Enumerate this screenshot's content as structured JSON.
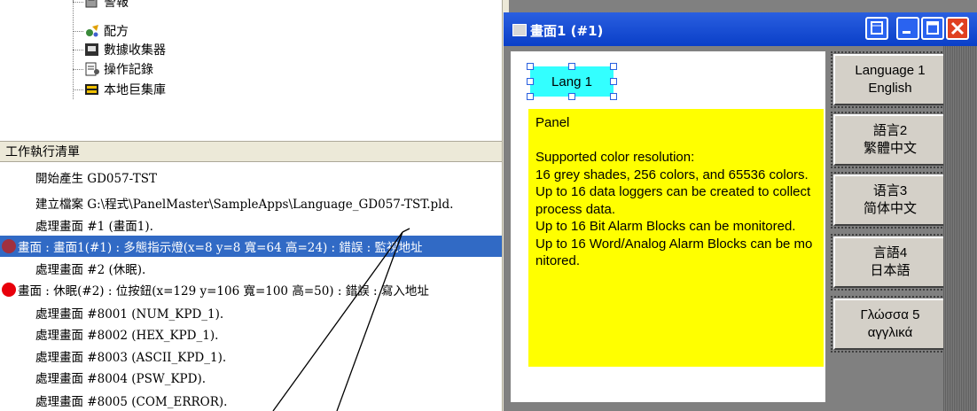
{
  "tree": {
    "items": [
      {
        "label": "警報",
        "icon": "alarm-icon"
      },
      {
        "label": "配方",
        "icon": "recipe-icon"
      },
      {
        "label": "數據收集器",
        "icon": "data-collector-icon"
      },
      {
        "label": "操作記錄",
        "icon": "operation-log-icon"
      },
      {
        "label": "本地巨集庫",
        "icon": "macro-library-icon"
      }
    ]
  },
  "task_list": {
    "header": "工作執行清單",
    "rows": [
      {
        "text": "開始產生 GD057-TST",
        "type": "info"
      },
      {
        "text": "建立檔案 G:\\程式\\PanelMaster\\SampleApps\\Language_GD057-TST.pld.",
        "type": "info"
      },
      {
        "text": "處理畫面 #1 (畫面1).",
        "type": "info"
      },
      {
        "text": "畫面 : 畫面1(#1) : 多態指示燈(x=8 y=8 寬=64 高=24) : 錯誤 : 監視地址",
        "type": "error",
        "selected": true
      },
      {
        "text": "處理畫面 #2 (休眠).",
        "type": "info"
      },
      {
        "text": "畫面 : 休眠(#2) : 位按鈕(x=129 y=106 寬=100 高=50) : 錯誤 : 寫入地址",
        "type": "error"
      },
      {
        "text": "處理畫面 #8001 (NUM_KPD_1).",
        "type": "info"
      },
      {
        "text": "處理畫面 #8002 (HEX_KPD_1).",
        "type": "info"
      },
      {
        "text": "處理畫面 #8003 (ASCII_KPD_1).",
        "type": "info"
      },
      {
        "text": "處理畫面 #8004 (PSW_KPD).",
        "type": "info"
      },
      {
        "text": "處理畫面 #8005 (COM_ERROR).",
        "type": "info"
      }
    ]
  },
  "window": {
    "title": "畫面1 (#1)",
    "buttons": {
      "restore": "restore-icon",
      "minimize": "minimize-icon",
      "maximize": "maximize-icon",
      "close": "close-icon"
    }
  },
  "screen": {
    "lang_selector": "Lang 1",
    "panel_text": "Panel\n\nSupported color resolution:\n16 grey shades, 256 colors, and 65536 colors.\nUp to 16 data loggers can be created to collect process data.\nUp to 16 Bit Alarm Blocks can be monitored.\nUp to 16 Word/Analog Alarm Blocks can be monitored.",
    "language_buttons": [
      {
        "line1": "Language 1",
        "line2": "English"
      },
      {
        "line1": "語言2",
        "line2": "繁體中文"
      },
      {
        "line1": "语言3",
        "line2": "简体中文"
      },
      {
        "line1": "言語4",
        "line2": "日本語"
      },
      {
        "line1": "Γλώσσα 5",
        "line2": "αγγλικά"
      }
    ]
  },
  "colors": {
    "selection": "#316ac5",
    "panel_bg": "#ffff00",
    "lang_selector_bg": "#33ffff",
    "titlebar": "#0a3fc8",
    "error_dot": "#e8000b"
  }
}
